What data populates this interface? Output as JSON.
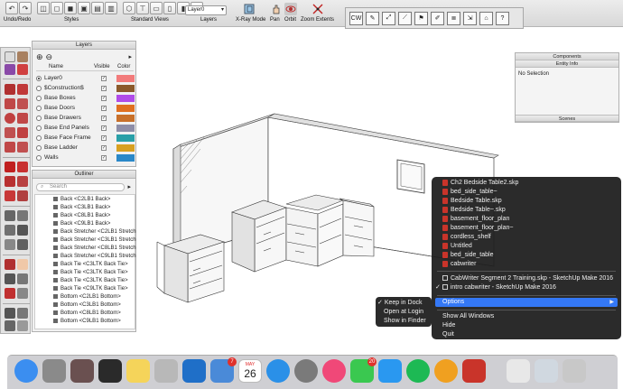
{
  "toolbar": {
    "groups": [
      {
        "label": "Undo/Redo"
      },
      {
        "label": "Styles"
      },
      {
        "label": "Standard Views"
      },
      {
        "label": "Layers"
      },
      {
        "label": "X-Ray Mode"
      },
      {
        "label": "Pan"
      },
      {
        "label": "Orbit"
      },
      {
        "label": "Zoom Extents"
      }
    ],
    "layer_value": "Layer0"
  },
  "layers_panel": {
    "title": "Layers",
    "columns": {
      "name": "Name",
      "visible": "Visible",
      "color": "Color"
    },
    "rows": [
      {
        "name": "Layer0",
        "active": true,
        "color": "#f27b7b"
      },
      {
        "name": "$Construction$",
        "active": false,
        "color": "#8b5a2b"
      },
      {
        "name": "Base Boxes",
        "active": false,
        "color": "#b04ce8"
      },
      {
        "name": "Base Doors",
        "active": false,
        "color": "#e07020"
      },
      {
        "name": "Base Drawers",
        "active": false,
        "color": "#c8702a"
      },
      {
        "name": "Base End Panels",
        "active": false,
        "color": "#8e8ea8"
      },
      {
        "name": "Base Face Frame",
        "active": false,
        "color": "#2aa0a8"
      },
      {
        "name": "Base Ladder",
        "active": false,
        "color": "#d8a020"
      },
      {
        "name": "Walls",
        "active": false,
        "color": "#2a88c8"
      }
    ]
  },
  "outliner_panel": {
    "title": "Outliner",
    "search_placeholder": "Search",
    "items": [
      "Back <C2LB1 Back>",
      "Back <C3LB1 Back>",
      "Back <C8LB1 Back>",
      "Back <C9LB1 Back>",
      "Back Stretcher <C2LB1 Stretch",
      "Back Stretcher <C3LB1 Stretch",
      "Back Stretcher <C8LB1 Stretch",
      "Back Stretcher <C9LB1 Stretch",
      "Back Tie <C3LTK Back Tie>",
      "Back Tie <C3LTK Back Tie>",
      "Back Tie <C3LTK Back Tie>",
      "Back Tie <C9LTK Back Tie>",
      "Bottom <C2LB1 Bottom>",
      "Bottom <C3LB1 Bottom>",
      "Bottom <C8LB1 Bottom>",
      "Bottom <C9LB1 Bottom>"
    ]
  },
  "right_panel": {
    "components_title": "Components",
    "entity_info_title": "Entity Info",
    "selection": "No Selection",
    "scenes_title": "Scenes"
  },
  "dock_menu": {
    "recent_files": [
      "Ch2 Bedside Table2.skp",
      "bed_side_table~",
      "Bedside Table.skp",
      "Bedside Table~.skp",
      "basement_floor_plan",
      "basement_floor_plan~",
      "cordless_shelf",
      "Untitled",
      "bed_side_table",
      "cabwriter"
    ],
    "windows": [
      {
        "label": "CabWriter Segment 2 Training.skp - SketchUp Make 2016",
        "checked": false
      },
      {
        "label": "intro cabwriter - SketchUp Make 2016",
        "checked": true
      }
    ],
    "options_label": "Options",
    "options_arrow": "▶",
    "show_all_windows": "Show All Windows",
    "hide": "Hide",
    "quit": "Quit"
  },
  "options_submenu": {
    "keep_in_dock": "Keep in Dock",
    "open_at_login": "Open at Login",
    "show_in_finder": "Show in Finder",
    "check": "✓"
  },
  "dock": {
    "icons": [
      {
        "name": "finder",
        "color": "#3b8ef0"
      },
      {
        "name": "launchpad",
        "color": "#8a8a8a"
      },
      {
        "name": "photo-booth",
        "color": "#6a5050"
      },
      {
        "name": "activity-monitor",
        "color": "#2a2a2a"
      },
      {
        "name": "notes",
        "color": "#f5d45a"
      },
      {
        "name": "preview",
        "color": "#b8b8b8"
      },
      {
        "name": "outlook",
        "color": "#1f6fc8"
      },
      {
        "name": "mail-stamps",
        "color": "#4a8ad8"
      },
      {
        "name": "calendar",
        "color": "#ffffff"
      },
      {
        "name": "safari",
        "color": "#2a90e8"
      },
      {
        "name": "system-preferences",
        "color": "#7a7a7a"
      },
      {
        "name": "itunes",
        "color": "#f04878"
      },
      {
        "name": "messages",
        "color": "#3ac850"
      },
      {
        "name": "app-store",
        "color": "#2a98f0"
      },
      {
        "name": "spotify",
        "color": "#1db954"
      },
      {
        "name": "photos",
        "color": "#f0a020"
      },
      {
        "name": "sketchup",
        "color": "#c9342a"
      },
      {
        "name": "documents-stack",
        "color": "#e8e8e8"
      },
      {
        "name": "downloads-stack",
        "color": "#d0d8e0"
      },
      {
        "name": "trash",
        "color": "#c8c8c8"
      }
    ],
    "badges": {
      "mail": "7",
      "messages": "20"
    },
    "calendar_month": "MAY",
    "calendar_day": "26"
  }
}
